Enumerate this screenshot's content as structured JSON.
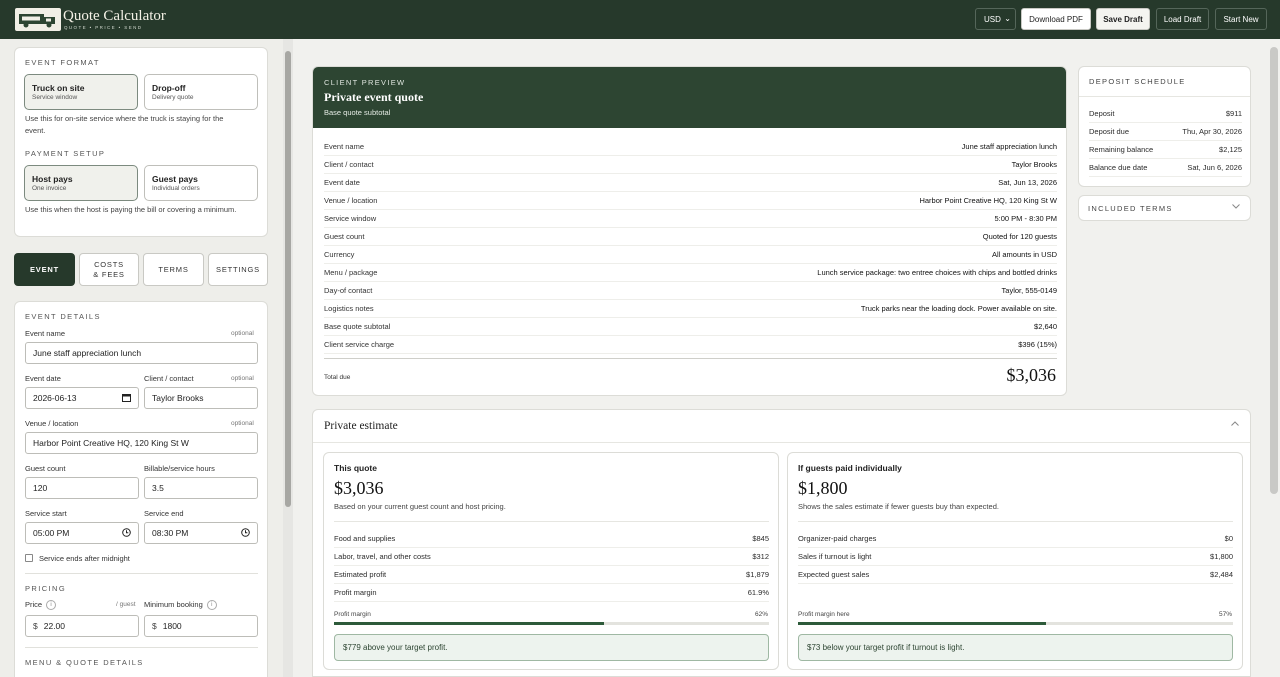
{
  "app": {
    "brand": "Quote Calculator",
    "tagline": "QUOTE • PRICE • SEND",
    "currency": "USD",
    "buttons": {
      "download_pdf": "Download PDF",
      "save_draft": "Save Draft",
      "load_draft": "Load Draft",
      "start_new": "Start New"
    }
  },
  "sidebar": {
    "event_format": {
      "heading": "EVENT FORMAT",
      "options": [
        {
          "title": "Truck on site",
          "subtitle": "Service window"
        },
        {
          "title": "Drop-off",
          "subtitle": "Delivery quote"
        }
      ],
      "hint": "Use this for on-site service where the truck is staying for the event."
    },
    "payment_setup": {
      "heading": "PAYMENT SETUP",
      "options": [
        {
          "title": "Host pays",
          "subtitle": "One invoice"
        },
        {
          "title": "Guest pays",
          "subtitle": "Individual orders"
        }
      ],
      "hint": "Use this when the host is paying the bill or covering a minimum."
    },
    "tabs": [
      "EVENT",
      "COSTS & FEES",
      "TERMS",
      "SETTINGS"
    ],
    "event_details": {
      "heading": "EVENT DETAILS",
      "optional": "optional",
      "event_name_label": "Event name",
      "event_name": "June staff appreciation lunch",
      "event_date_label": "Event date",
      "event_date": "2026-06-13",
      "client_label": "Client / contact",
      "client": "Taylor Brooks",
      "venue_label": "Venue / location",
      "venue": "Harbor Point Creative HQ, 120 King St W",
      "guest_count_label": "Guest count",
      "guest_count": "120",
      "hours_label": "Billable/service hours",
      "hours": "3.5",
      "start_label": "Service start",
      "start": "05:00 PM",
      "end_label": "Service end",
      "end": "08:30 PM",
      "midnight_label": "Service ends after midnight"
    },
    "pricing": {
      "heading": "PRICING",
      "price_label": "Price",
      "per_guest": "/ guest",
      "price_prefix": "$",
      "price": "22.00",
      "min_label": "Minimum booking",
      "min_prefix": "$",
      "min": "1800"
    },
    "menu_heading": "MENU & QUOTE DETAILS"
  },
  "preview": {
    "eyebrow": "CLIENT PREVIEW",
    "title": "Private event quote",
    "subtitle": "Base quote subtotal",
    "rows": [
      {
        "k": "Event name",
        "v": "June staff appreciation lunch"
      },
      {
        "k": "Client / contact",
        "v": "Taylor Brooks"
      },
      {
        "k": "Event date",
        "v": "Sat, Jun 13, 2026"
      },
      {
        "k": "Venue / location",
        "v": "Harbor Point Creative HQ, 120 King St W"
      },
      {
        "k": "Service window",
        "v": "5:00 PM - 8:30 PM"
      },
      {
        "k": "Guest count",
        "v": "Quoted for 120 guests"
      },
      {
        "k": "Currency",
        "v": "All amounts in USD"
      },
      {
        "k": "Menu / package",
        "v": "Lunch service package: two entree choices with chips and bottled drinks"
      },
      {
        "k": "Day-of contact",
        "v": "Taylor, 555-0149"
      },
      {
        "k": "Logistics notes",
        "v": "Truck parks near the loading dock. Power available on site."
      },
      {
        "k": "Base quote subtotal",
        "v": "$2,640"
      },
      {
        "k": "Client service charge",
        "v": "$396 (15%)"
      }
    ],
    "total_label": "Total due",
    "total": "$3,036"
  },
  "deposit": {
    "heading": "DEPOSIT SCHEDULE",
    "rows": [
      {
        "k": "Deposit",
        "v": "$911"
      },
      {
        "k": "Deposit due",
        "v": "Thu, Apr 30, 2026"
      },
      {
        "k": "Remaining balance",
        "v": "$2,125"
      },
      {
        "k": "Balance due date",
        "v": "Sat, Jun 6, 2026"
      }
    ]
  },
  "terms": {
    "heading": "INCLUDED TERMS"
  },
  "estimate": {
    "title": "Private estimate",
    "this_quote": {
      "title": "This quote",
      "amount": "$3,036",
      "note": "Based on your current guest count and host pricing.",
      "rows": [
        {
          "k": "Food and supplies",
          "v": "$845"
        },
        {
          "k": "Labor, travel, and other costs",
          "v": "$312"
        },
        {
          "k": "Estimated profit",
          "v": "$1,879"
        },
        {
          "k": "Profit margin",
          "v": "61.9%"
        }
      ],
      "bar_label": "Profit margin",
      "bar_value": "62%",
      "bar_fraction": 0.62,
      "callout": "$779 above your target profit."
    },
    "individual": {
      "title": "If guests paid individually",
      "amount": "$1,800",
      "note": "Shows the sales estimate if fewer guests buy than expected.",
      "rows": [
        {
          "k": "Organizer-paid charges",
          "v": "$0"
        },
        {
          "k": "Sales if turnout is light",
          "v": "$1,800"
        },
        {
          "k": "Expected guest sales",
          "v": "$2,484"
        }
      ],
      "bar_label": "Profit margin here",
      "bar_value": "57%",
      "bar_fraction": 0.57,
      "callout": "$73 below your target profit if turnout is light."
    }
  }
}
